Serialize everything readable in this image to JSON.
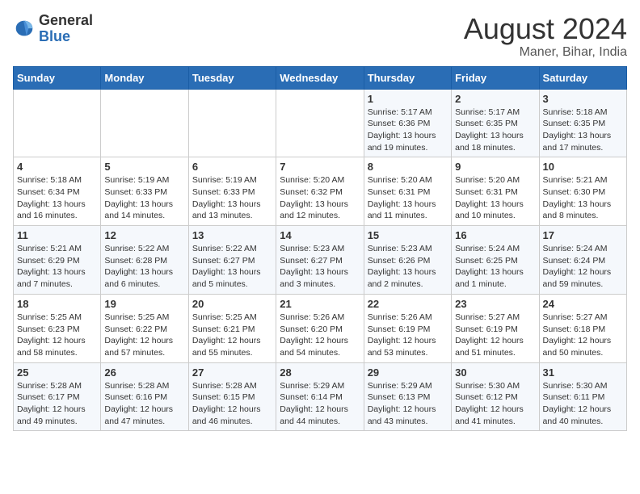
{
  "header": {
    "logo_line1": "General",
    "logo_line2": "Blue",
    "month_year": "August 2024",
    "location": "Maner, Bihar, India"
  },
  "days_of_week": [
    "Sunday",
    "Monday",
    "Tuesday",
    "Wednesday",
    "Thursday",
    "Friday",
    "Saturday"
  ],
  "weeks": [
    [
      {
        "day": "",
        "info": ""
      },
      {
        "day": "",
        "info": ""
      },
      {
        "day": "",
        "info": ""
      },
      {
        "day": "",
        "info": ""
      },
      {
        "day": "1",
        "info": "Sunrise: 5:17 AM\nSunset: 6:36 PM\nDaylight: 13 hours\nand 19 minutes."
      },
      {
        "day": "2",
        "info": "Sunrise: 5:17 AM\nSunset: 6:35 PM\nDaylight: 13 hours\nand 18 minutes."
      },
      {
        "day": "3",
        "info": "Sunrise: 5:18 AM\nSunset: 6:35 PM\nDaylight: 13 hours\nand 17 minutes."
      }
    ],
    [
      {
        "day": "4",
        "info": "Sunrise: 5:18 AM\nSunset: 6:34 PM\nDaylight: 13 hours\nand 16 minutes."
      },
      {
        "day": "5",
        "info": "Sunrise: 5:19 AM\nSunset: 6:33 PM\nDaylight: 13 hours\nand 14 minutes."
      },
      {
        "day": "6",
        "info": "Sunrise: 5:19 AM\nSunset: 6:33 PM\nDaylight: 13 hours\nand 13 minutes."
      },
      {
        "day": "7",
        "info": "Sunrise: 5:20 AM\nSunset: 6:32 PM\nDaylight: 13 hours\nand 12 minutes."
      },
      {
        "day": "8",
        "info": "Sunrise: 5:20 AM\nSunset: 6:31 PM\nDaylight: 13 hours\nand 11 minutes."
      },
      {
        "day": "9",
        "info": "Sunrise: 5:20 AM\nSunset: 6:31 PM\nDaylight: 13 hours\nand 10 minutes."
      },
      {
        "day": "10",
        "info": "Sunrise: 5:21 AM\nSunset: 6:30 PM\nDaylight: 13 hours\nand 8 minutes."
      }
    ],
    [
      {
        "day": "11",
        "info": "Sunrise: 5:21 AM\nSunset: 6:29 PM\nDaylight: 13 hours\nand 7 minutes."
      },
      {
        "day": "12",
        "info": "Sunrise: 5:22 AM\nSunset: 6:28 PM\nDaylight: 13 hours\nand 6 minutes."
      },
      {
        "day": "13",
        "info": "Sunrise: 5:22 AM\nSunset: 6:27 PM\nDaylight: 13 hours\nand 5 minutes."
      },
      {
        "day": "14",
        "info": "Sunrise: 5:23 AM\nSunset: 6:27 PM\nDaylight: 13 hours\nand 3 minutes."
      },
      {
        "day": "15",
        "info": "Sunrise: 5:23 AM\nSunset: 6:26 PM\nDaylight: 13 hours\nand 2 minutes."
      },
      {
        "day": "16",
        "info": "Sunrise: 5:24 AM\nSunset: 6:25 PM\nDaylight: 13 hours\nand 1 minute."
      },
      {
        "day": "17",
        "info": "Sunrise: 5:24 AM\nSunset: 6:24 PM\nDaylight: 12 hours\nand 59 minutes."
      }
    ],
    [
      {
        "day": "18",
        "info": "Sunrise: 5:25 AM\nSunset: 6:23 PM\nDaylight: 12 hours\nand 58 minutes."
      },
      {
        "day": "19",
        "info": "Sunrise: 5:25 AM\nSunset: 6:22 PM\nDaylight: 12 hours\nand 57 minutes."
      },
      {
        "day": "20",
        "info": "Sunrise: 5:25 AM\nSunset: 6:21 PM\nDaylight: 12 hours\nand 55 minutes."
      },
      {
        "day": "21",
        "info": "Sunrise: 5:26 AM\nSunset: 6:20 PM\nDaylight: 12 hours\nand 54 minutes."
      },
      {
        "day": "22",
        "info": "Sunrise: 5:26 AM\nSunset: 6:19 PM\nDaylight: 12 hours\nand 53 minutes."
      },
      {
        "day": "23",
        "info": "Sunrise: 5:27 AM\nSunset: 6:19 PM\nDaylight: 12 hours\nand 51 minutes."
      },
      {
        "day": "24",
        "info": "Sunrise: 5:27 AM\nSunset: 6:18 PM\nDaylight: 12 hours\nand 50 minutes."
      }
    ],
    [
      {
        "day": "25",
        "info": "Sunrise: 5:28 AM\nSunset: 6:17 PM\nDaylight: 12 hours\nand 49 minutes."
      },
      {
        "day": "26",
        "info": "Sunrise: 5:28 AM\nSunset: 6:16 PM\nDaylight: 12 hours\nand 47 minutes."
      },
      {
        "day": "27",
        "info": "Sunrise: 5:28 AM\nSunset: 6:15 PM\nDaylight: 12 hours\nand 46 minutes."
      },
      {
        "day": "28",
        "info": "Sunrise: 5:29 AM\nSunset: 6:14 PM\nDaylight: 12 hours\nand 44 minutes."
      },
      {
        "day": "29",
        "info": "Sunrise: 5:29 AM\nSunset: 6:13 PM\nDaylight: 12 hours\nand 43 minutes."
      },
      {
        "day": "30",
        "info": "Sunrise: 5:30 AM\nSunset: 6:12 PM\nDaylight: 12 hours\nand 41 minutes."
      },
      {
        "day": "31",
        "info": "Sunrise: 5:30 AM\nSunset: 6:11 PM\nDaylight: 12 hours\nand 40 minutes."
      }
    ]
  ]
}
